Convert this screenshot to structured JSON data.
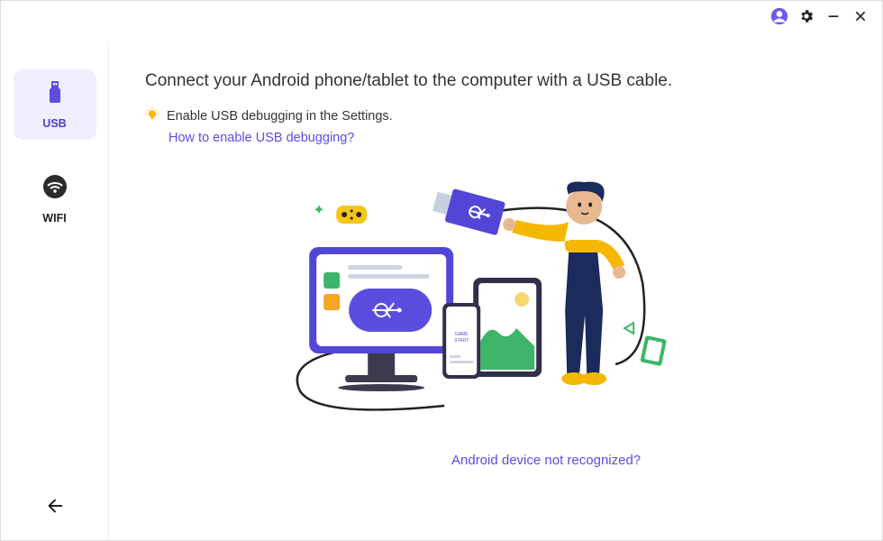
{
  "titlebar": {
    "account_icon": "account-icon",
    "settings_icon": "gear-icon",
    "minimize_icon": "minimize-icon",
    "close_icon": "close-icon"
  },
  "sidebar": {
    "tabs": [
      {
        "id": "usb",
        "label": "USB",
        "active": true
      },
      {
        "id": "wifi",
        "label": "WIFI",
        "active": false
      }
    ],
    "back_icon": "back-arrow-icon"
  },
  "main": {
    "heading": "Connect your Android phone/tablet to the computer with a USB cable.",
    "hint_icon": "lightbulb-icon",
    "hint_text": "Enable USB debugging in the Settings.",
    "help_link": "How to enable USB debugging?",
    "footer_link": "Android device not recognized?"
  },
  "colors": {
    "accent": "#5a4de0",
    "active_bg": "#efeefc"
  }
}
